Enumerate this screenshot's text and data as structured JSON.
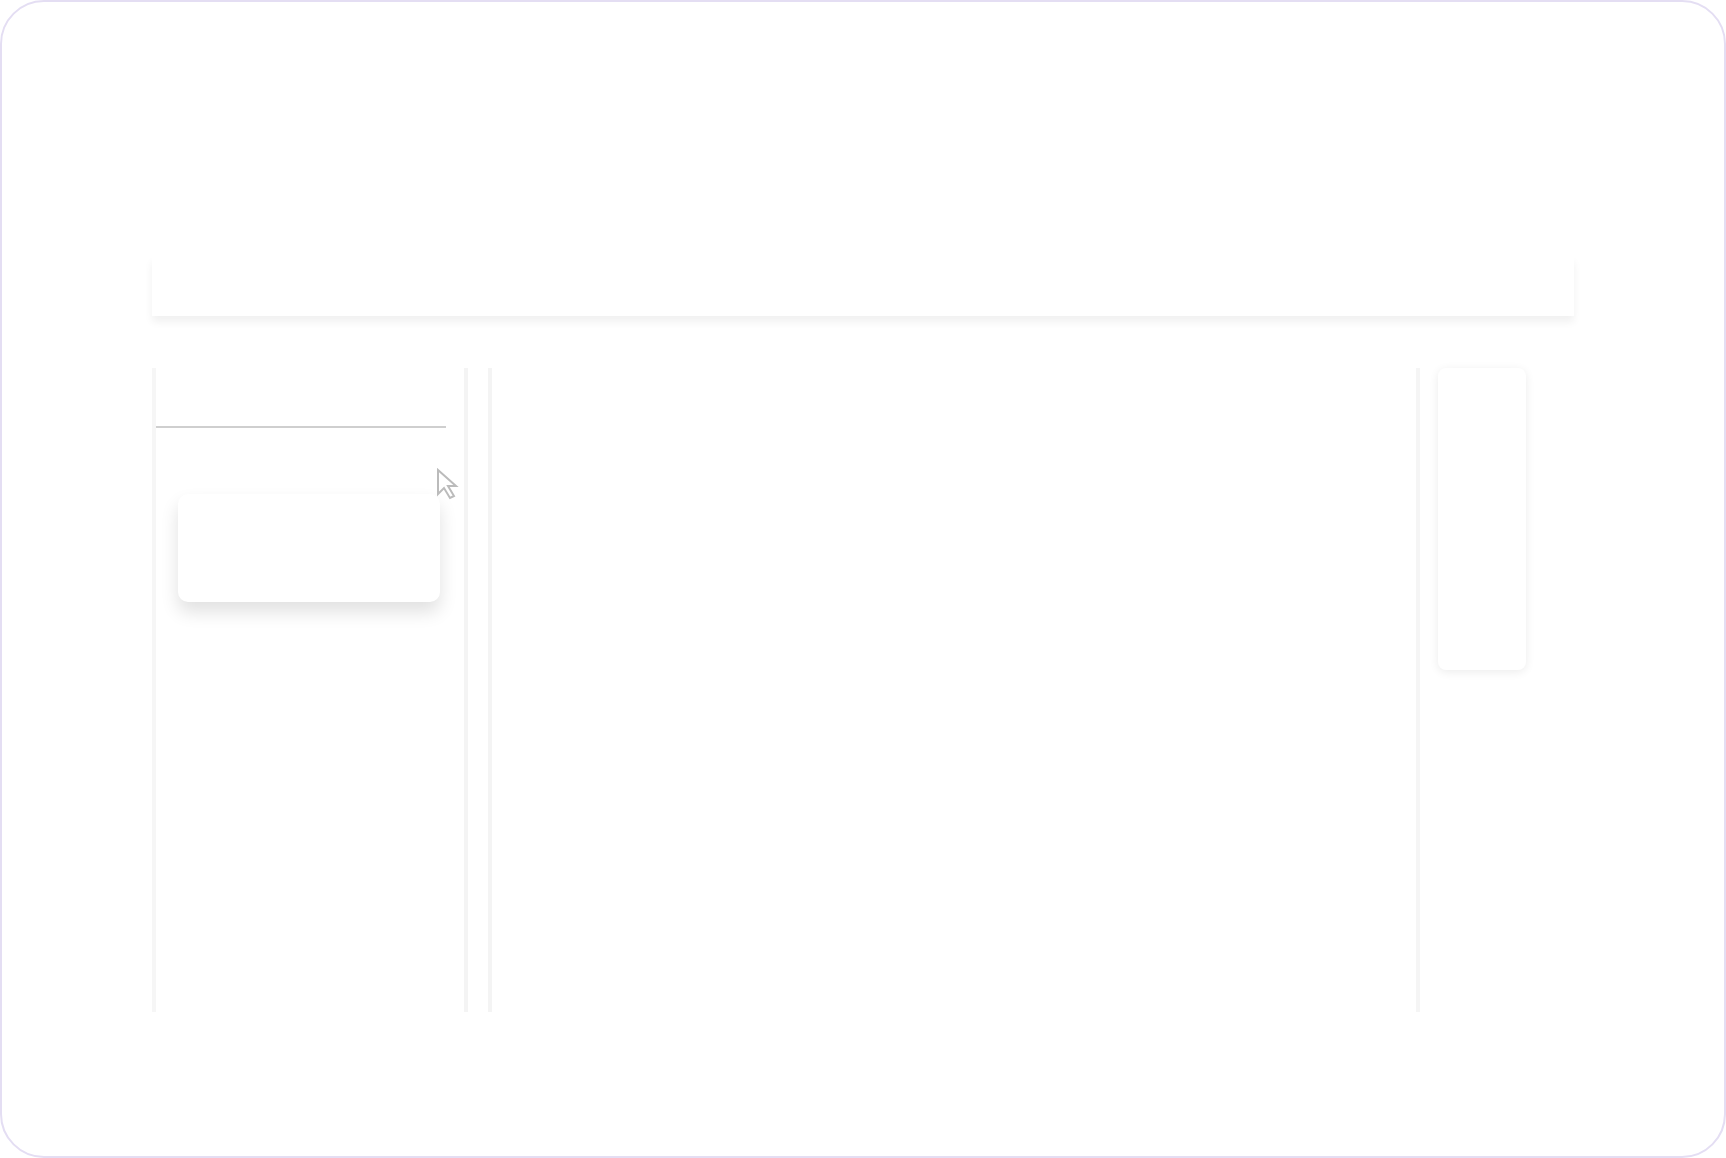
{
  "page": {
    "kind": "wireframe"
  }
}
